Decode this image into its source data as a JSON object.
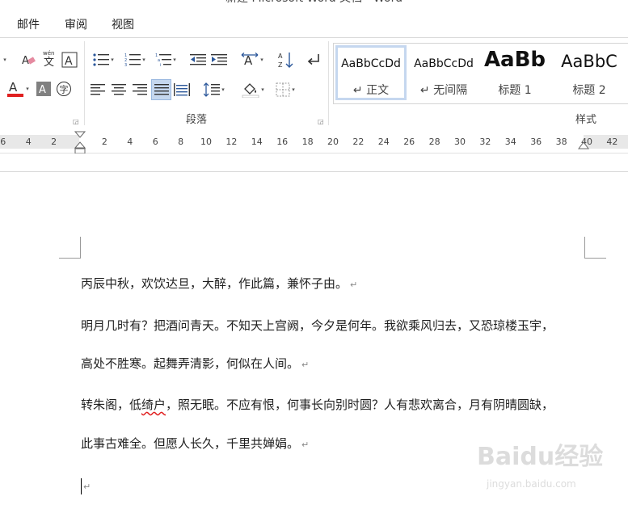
{
  "window": {
    "title": "新建 Microsoft Word 文档 - Word"
  },
  "menu": {
    "tabs": [
      "邮件",
      "审阅",
      "视图"
    ]
  },
  "ribbon": {
    "groups": {
      "paragraph": "段落",
      "styles": "样式"
    },
    "styles": [
      {
        "sample": "AaBbCcDd",
        "name": "↵ 正文"
      },
      {
        "sample": "AaBbCcDd",
        "name": "↵ 无间隔"
      },
      {
        "sample": "AaBb",
        "name": "标题 1"
      },
      {
        "sample": "AaBbC",
        "name": "标题 2"
      }
    ],
    "font_color": "#e02020",
    "highlight_color": "#808080"
  },
  "ruler": {
    "numbers": [
      "6",
      "4",
      "2",
      "2",
      "4",
      "6",
      "8",
      "10",
      "12",
      "14",
      "16",
      "18",
      "20",
      "22",
      "24",
      "26",
      "28",
      "30",
      "32",
      "34",
      "36",
      "38",
      "40",
      "42"
    ]
  },
  "document": {
    "lines": [
      {
        "text": "丙辰中秋，欢饮达旦，大醉，作此篇，兼怀子由。",
        "mark": "↵"
      },
      {
        "text": "明月几时有？把酒问青天。不知天上宫阙，今夕是何年。我欲乘风归去，又恐琼楼玉宇，",
        "mark": ""
      },
      {
        "text": "高处不胜寒。起舞弄清影，何似在人间。",
        "mark": "↵"
      },
      {
        "pre": "转朱阁，低",
        "squiggle": "绮户",
        "post": "，照无眠。不应有恨，何事长向别时圆？人有悲欢离合，月有阴晴圆缺，",
        "mark": ""
      },
      {
        "text": "此事古难全。但愿人长久，千里共婵娟。",
        "mark": "↵"
      },
      {
        "text": "",
        "mark": "↵"
      }
    ]
  },
  "watermark": {
    "text": "Baidu经验",
    "sub": "jingyan.baidu.com"
  }
}
